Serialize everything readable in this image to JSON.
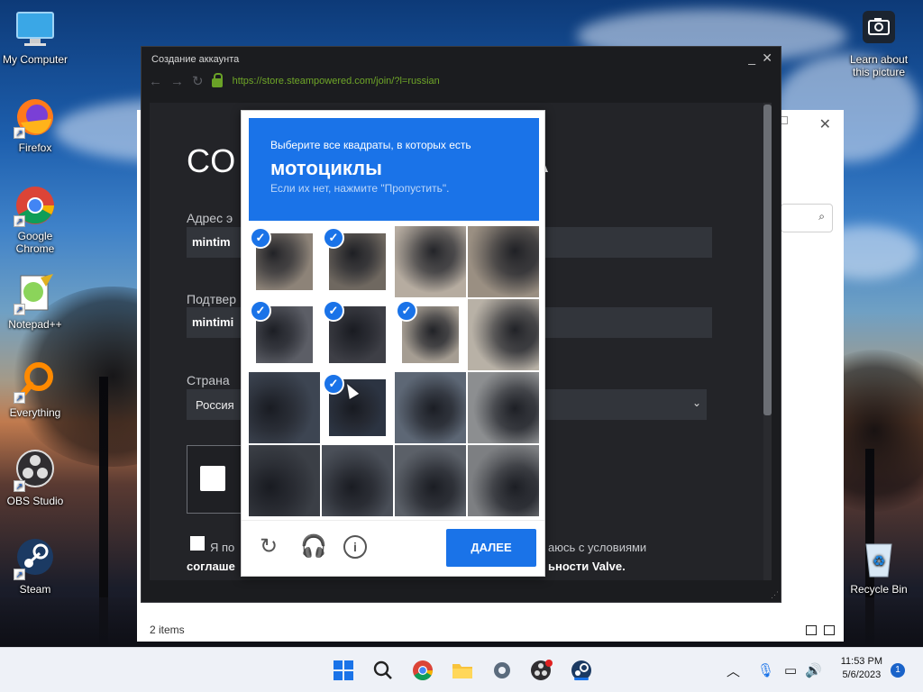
{
  "desktop": {
    "icons": [
      {
        "label": "My Computer"
      },
      {
        "label": "Firefox"
      },
      {
        "label": "Google Chrome"
      },
      {
        "label": "Notepad++"
      },
      {
        "label": "Everything"
      },
      {
        "label": "OBS Studio"
      },
      {
        "label": "Steam"
      }
    ],
    "right_icons": [
      {
        "label": "Learn about this picture"
      },
      {
        "label": "Recycle Bin"
      }
    ]
  },
  "explorer": {
    "status": "2 items"
  },
  "steam_window": {
    "title": "Создание аккаунта",
    "url": "https://store.steampowered.com/join/?l=russian",
    "page": {
      "title_left": "СО",
      "title_right": "А",
      "email_label": "Адрес э",
      "email_value": "mintim",
      "confirm_label": "Подтвер",
      "confirm_value": "mintimi",
      "country_label": "Страна",
      "country_value": "Россия",
      "agree_left": "Я по",
      "agree_right": "аюсь с условиями",
      "agree_bold_left": "соглаше",
      "agree_bold_right": "ьности Valve."
    }
  },
  "captcha": {
    "instruction": "Выберите все квадраты, в которых есть",
    "target": "мотоциклы",
    "hint": "Если их нет, нажмите \"Пропустить\".",
    "next_label": "ДАЛЕЕ",
    "selected": [
      true,
      true,
      false,
      false,
      true,
      true,
      true,
      false,
      false,
      true,
      false,
      false,
      false,
      false,
      false,
      false
    ],
    "check_glyph": "✓",
    "accent": "#1a73e8"
  },
  "taskbar": {
    "time": "11:53 PM",
    "date": "5/6/2023",
    "notifications": "1"
  }
}
